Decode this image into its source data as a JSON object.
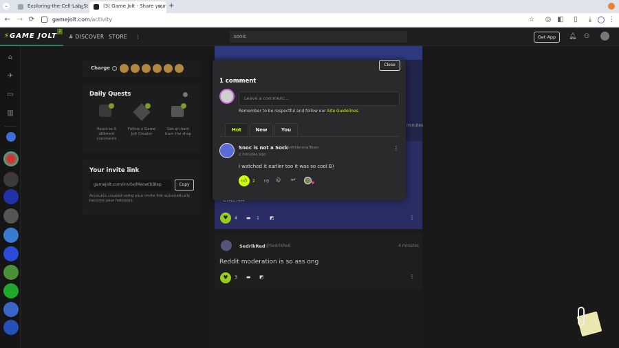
{
  "browser": {
    "tabs": [
      {
        "title": "Exploring-the-Cell-Lab_Stu"
      },
      {
        "title": "(3) Game Jolt - Share your c"
      }
    ],
    "url_domain": "gamejolt.com",
    "url_path": "/activity",
    "new_tab": "+",
    "nav": {
      "back": "←",
      "forward": "→",
      "reload": "⟳"
    }
  },
  "header": {
    "logo": "GAME JOLT",
    "logo_badge": "2",
    "discover": "DISCOVER",
    "store": "STORE",
    "more": "⋮",
    "search_value": "sonic",
    "get_app": "Get App"
  },
  "left": {
    "charge_label": "Charge",
    "daily_quests_title": "Daily Quests",
    "quests": [
      {
        "label": "React to 5 different comments"
      },
      {
        "label": "Follow a Game Jolt Creator"
      },
      {
        "label": "Get an item from the shop"
      }
    ],
    "invite_title": "Your invite link",
    "invite_link": "gamejolt.com/invite/MeowthBlep",
    "copy_label": "Copy",
    "invite_note": "Accounts created using your invite link automatically become your followers."
  },
  "feed": {
    "post1_time": "minutes",
    "post1_title": "CINEMA",
    "post1_likes": "4",
    "post1_comments": "1",
    "post2_author": "SedrikRed",
    "post2_handle": "@SedrikRed",
    "post2_time": "4 minutes",
    "post2_text": "Reddit moderation is so ass ong",
    "post2_likes": "3"
  },
  "modal": {
    "close_label": "Close",
    "title": "1 comment",
    "input_placeholder": "Leave a comment...",
    "guideline_prefix": "Remember to be respectful and follow our ",
    "guideline_link": "Site Guidelines",
    "guideline_suffix": ".",
    "tabs": [
      {
        "label": "Hot"
      },
      {
        "label": "New"
      },
      {
        "label": "You"
      }
    ],
    "comment": {
      "author": "Snoc is not a Sock",
      "handle": "@TheMillennialTown",
      "time": "2 minutes ago",
      "text": "i watched it earlier too it was so cool B)",
      "likes": "2"
    }
  },
  "colors": {
    "accent": "#ccff00",
    "bg": "#191919",
    "modal_bg": "#2a292c",
    "link": "#ccff00"
  }
}
